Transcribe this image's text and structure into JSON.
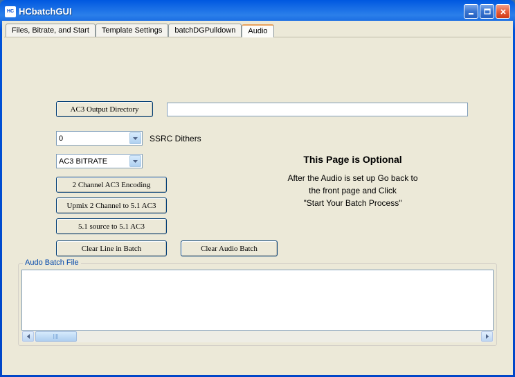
{
  "window": {
    "title": "HCbatchGUI"
  },
  "tabs": [
    {
      "label": "Files, Bitrate, and Start",
      "active": false
    },
    {
      "label": "Template Settings",
      "active": false
    },
    {
      "label": "batchDGPulldown",
      "active": false
    },
    {
      "label": "Audio",
      "active": true
    }
  ],
  "audio": {
    "ac3_output_dir_btn": "AC3 Output Directory",
    "ac3_output_dir_value": "",
    "ssrc_combo": "0",
    "ssrc_label": "SSRC Dithers",
    "bitrate_combo": "AC3 BITRATE",
    "btn_2ch": "2 Channel AC3 Encoding",
    "btn_upmix": "Upmix 2 Channel to 5.1 AC3",
    "btn_51src": "5.1 source to 5.1 AC3",
    "btn_clear_line": "Clear Line in Batch",
    "btn_clear_audio": "Clear Audio Batch",
    "info_heading": "This Page is Optional",
    "info_line1": "After the Audio is set up Go back to",
    "info_line2": "the front page and Click",
    "info_line3": "\"Start Your Batch Process\"",
    "batch_file_label": "Audo Batch File"
  }
}
